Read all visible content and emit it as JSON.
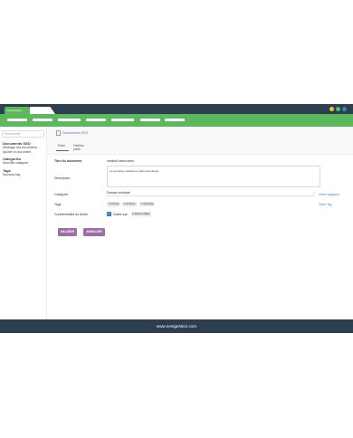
{
  "window": {
    "brand_tab_label": "NextGestion",
    "controls": [
      {
        "name": "minimize-dot",
        "color": "#f4c430"
      },
      {
        "name": "maximize-dot",
        "color": "#5cb85c"
      },
      {
        "name": "close-dot",
        "color": "#3b7ec3"
      }
    ]
  },
  "menubar": {
    "color": "#5cb85c",
    "item_count": 9
  },
  "sidebar": {
    "search_placeholder": "Rechercher",
    "groups": [
      {
        "title": "Documents GED",
        "links": [
          "Affichage des documents",
          "Ajouter un document"
        ]
      },
      {
        "title": "Catégories",
        "links": [
          "Nouvelle catégorie"
        ]
      },
      {
        "title": "Tags",
        "links": [
          "Nouveau tag"
        ]
      }
    ]
  },
  "breadcrumb": "Documents GED",
  "tabs": [
    "Fiche",
    "Fichiers joints"
  ],
  "form": {
    "title_label": "Titre du document",
    "title_value": "medical Instructions",
    "description_label": "Description",
    "description_value": "Le domaine médical et pharmaceutique",
    "category_label": "Catégorie",
    "category_value": "Dossier medicale",
    "create_category": "Créer catégorie",
    "tags_label": "Tags",
    "tags": [
      "Fichier",
      "Archive",
      "Sécurité"
    ],
    "create_tag": "Créer Tag",
    "confidentiality_label": "Confidentialité du fichier",
    "visible_by": "Visible par",
    "user": "Brown Mako"
  },
  "buttons": {
    "validate": "VALIDER",
    "cancel": "ANNULER",
    "color": "#9b6fa3"
  },
  "footer": "www.nextgestion.com"
}
